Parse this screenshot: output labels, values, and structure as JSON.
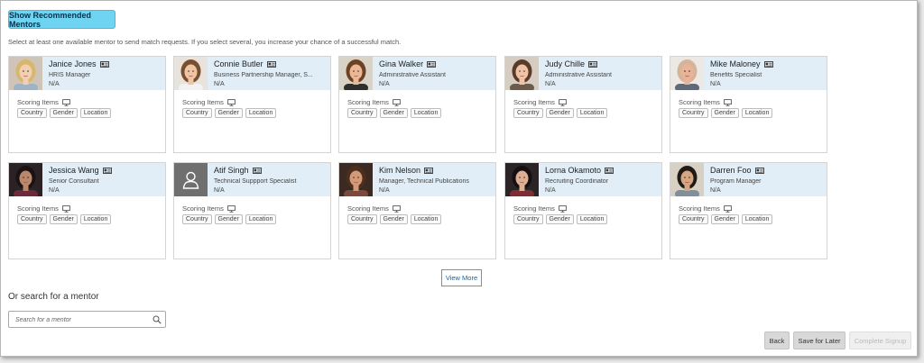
{
  "recommend_button": "Show Recommended Mentors",
  "instruction": "Select at least one available mentor to send match requests. If you select several, you increase your chance of a successful match.",
  "mentors": [
    {
      "name": "Janice Jones",
      "title": "HRIS Manager",
      "location": "N/A",
      "scoring_label": "Scoring Items",
      "tags": [
        "Country",
        "Gender",
        "Location"
      ],
      "photo": "female-blonde"
    },
    {
      "name": "Connie Butler",
      "title": "Business Partnership Manager, S...",
      "location": "N/A",
      "scoring_label": "Scoring Items",
      "tags": [
        "Country",
        "Gender",
        "Location"
      ],
      "photo": "female-brown"
    },
    {
      "name": "Gina Walker",
      "title": "Administrative Assistant",
      "location": "N/A",
      "scoring_label": "Scoring Items",
      "tags": [
        "Country",
        "Gender",
        "Location"
      ],
      "photo": "female-short-brown"
    },
    {
      "name": "Judy Chille",
      "title": "Administrative Assistant",
      "location": "N/A",
      "scoring_label": "Scoring Items",
      "tags": [
        "Country",
        "Gender",
        "Location"
      ],
      "photo": "female-curly"
    },
    {
      "name": "Mike Maloney",
      "title": "Benefits Specialist",
      "location": "N/A",
      "scoring_label": "Scoring Items",
      "tags": [
        "Country",
        "Gender",
        "Location"
      ],
      "photo": "male-bald"
    },
    {
      "name": "Jessica Wang",
      "title": "Senior Consultant",
      "location": "N/A",
      "scoring_label": "Scoring Items",
      "tags": [
        "Country",
        "Gender",
        "Location"
      ],
      "photo": "female-dark"
    },
    {
      "name": "Atif Singh",
      "title": "Technical Suppport Specialist",
      "location": "N/A",
      "scoring_label": "Scoring Items",
      "tags": [
        "Country",
        "Gender",
        "Location"
      ],
      "photo": "placeholder"
    },
    {
      "name": "Kim Nelson",
      "title": "Manager, Technical Publications",
      "location": "N/A",
      "scoring_label": "Scoring Items",
      "tags": [
        "Country",
        "Gender",
        "Location"
      ],
      "photo": "female-smile"
    },
    {
      "name": "Lorna Okamoto",
      "title": "Recruiting Coordinator",
      "location": "N/A",
      "scoring_label": "Scoring Items",
      "tags": [
        "Country",
        "Gender",
        "Location"
      ],
      "photo": "female-dark-hair"
    },
    {
      "name": "Darren Foo",
      "title": "Program Manager",
      "location": "N/A",
      "scoring_label": "Scoring Items",
      "tags": [
        "Country",
        "Gender",
        "Location"
      ],
      "photo": "male-dark"
    }
  ],
  "view_more": "View More",
  "search": {
    "heading": "Or search for a mentor",
    "placeholder": "Search for a mentor"
  },
  "footer": {
    "back": "Back",
    "save_later": "Save for Later",
    "complete": "Complete Signup"
  },
  "colors": {
    "accent": "#6fd3f2",
    "card_header": "#e1eef7",
    "focus_outline": "#e0742b",
    "link": "#1a5fa8"
  }
}
